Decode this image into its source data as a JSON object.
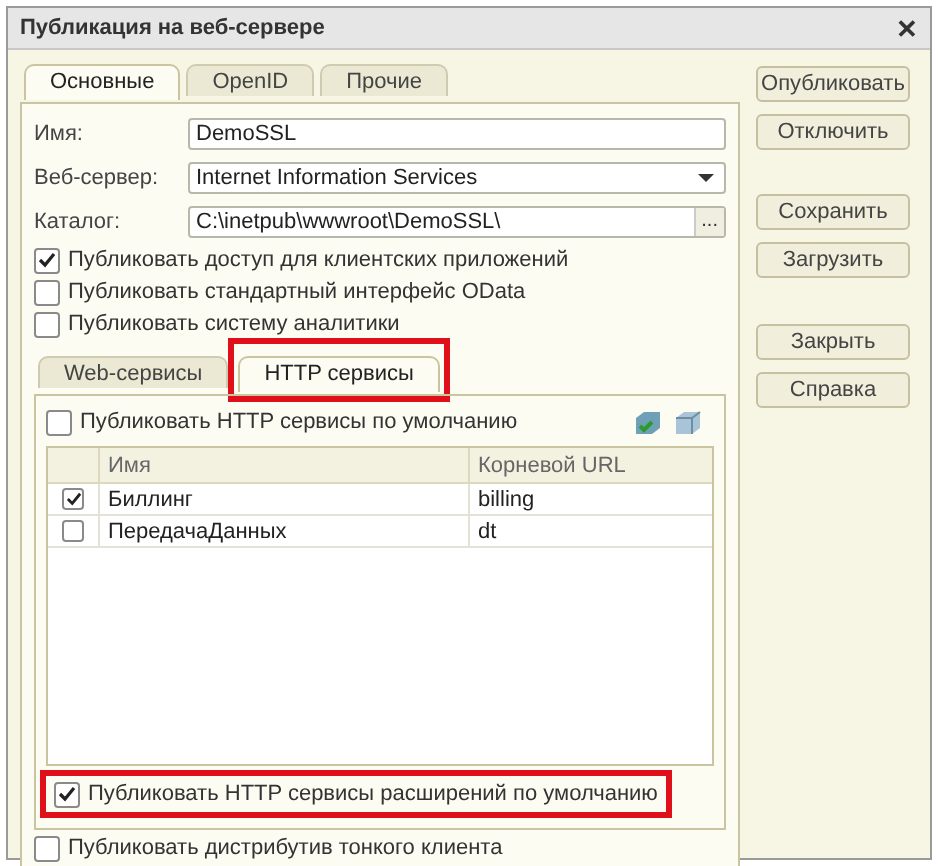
{
  "window": {
    "title": "Публикация на веб-сервере",
    "close": "✕"
  },
  "tabs": [
    {
      "label": "Основные",
      "selected": true
    },
    {
      "label": "OpenID",
      "selected": false
    },
    {
      "label": "Прочие",
      "selected": false
    }
  ],
  "fields": [
    {
      "kind": "text",
      "label": "Имя:",
      "value": "DemoSSL"
    },
    {
      "kind": "select",
      "label": "Веб-сервер:",
      "value": "Internet Information Services"
    },
    {
      "kind": "browse",
      "label": "Каталог:",
      "value": "C:\\inetpub\\wwwroot\\DemoSSL\\",
      "button": "..."
    }
  ],
  "options": [
    {
      "label": "Публиковать доступ для клиентских приложений",
      "checked": true
    },
    {
      "label": "Публиковать стандартный интерфейс OData",
      "checked": false
    },
    {
      "label": "Публиковать систему аналитики",
      "checked": false
    }
  ],
  "inner_tabs": [
    {
      "label": "Web-сервисы",
      "selected": false,
      "highlighted": false
    },
    {
      "label": "HTTP сервисы",
      "selected": true,
      "highlighted": true
    }
  ],
  "default_option": {
    "label": "Публиковать HTTP сервисы по умолчанию",
    "checked": false
  },
  "table": {
    "columns": [
      "Имя",
      "Корневой URL"
    ],
    "rows": [
      {
        "checked": true,
        "name": "Биллинг",
        "url": "billing"
      },
      {
        "checked": false,
        "name": "ПередачаДанных",
        "url": "dt"
      }
    ]
  },
  "extension_option": {
    "label": "Публиковать HTTP сервисы расширений по умолчанию",
    "checked": true,
    "highlighted": true
  },
  "thin_client_option": {
    "label": "Публиковать дистрибутив тонкого клиента",
    "checked": false
  },
  "buttons": [
    {
      "label": "Опубликовать"
    },
    {
      "label": "Отключить"
    },
    {
      "label": "Сохранить"
    },
    {
      "label": "Загрузить"
    },
    {
      "label": "Закрыть"
    },
    {
      "label": "Справка"
    }
  ]
}
